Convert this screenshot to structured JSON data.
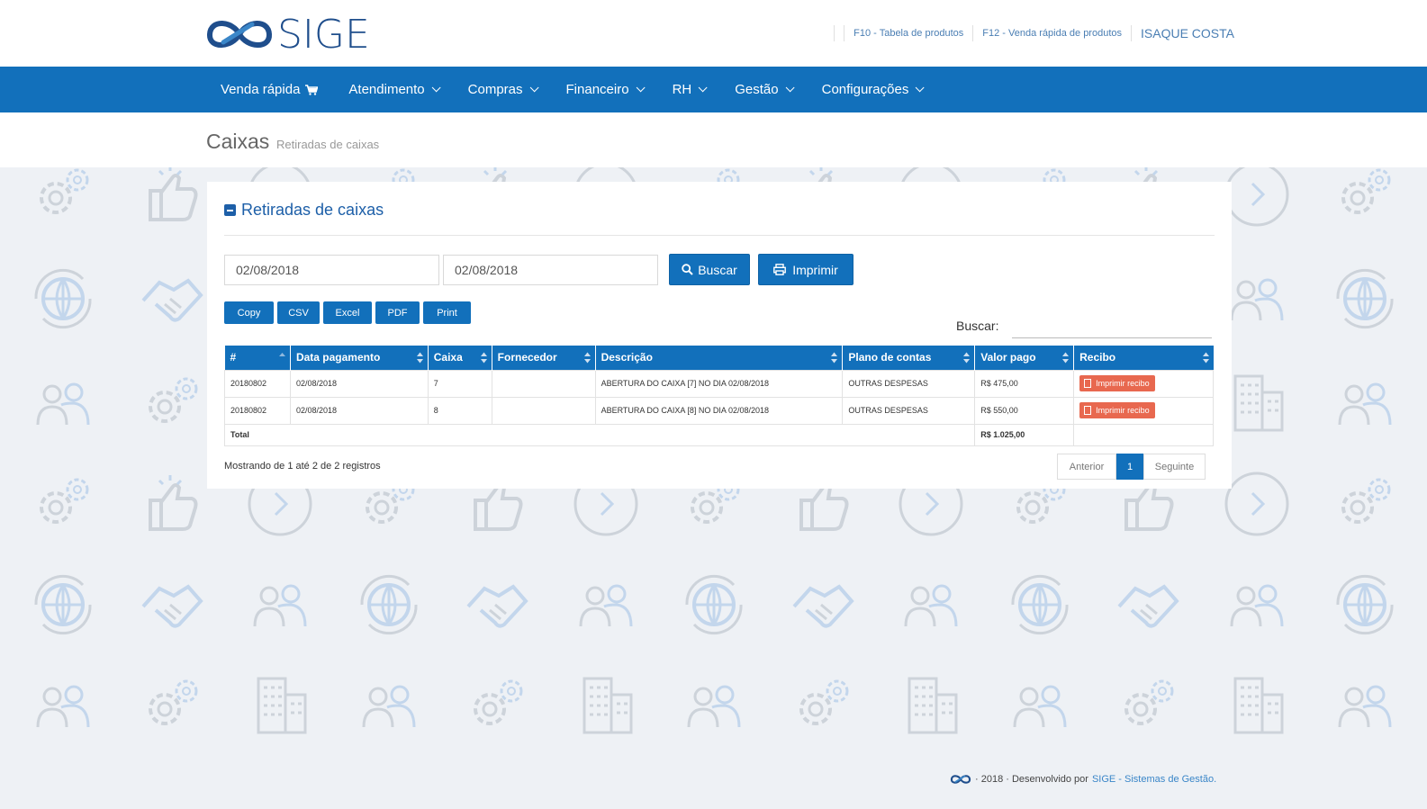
{
  "header": {
    "logo_text": "SIGE",
    "links": [
      "F10 - Tabela de produtos",
      "F12 - Venda rápida de produtos"
    ],
    "user": "ISAQUE COSTA"
  },
  "nav": {
    "items": [
      {
        "label": "Venda rápida",
        "icon": "cart-icon"
      },
      {
        "label": "Atendimento",
        "icon": "chevron-down-icon"
      },
      {
        "label": "Compras",
        "icon": "chevron-down-icon"
      },
      {
        "label": "Financeiro",
        "icon": "chevron-down-icon"
      },
      {
        "label": "RH",
        "icon": "chevron-down-icon"
      },
      {
        "label": "Gestão",
        "icon": "chevron-down-icon"
      },
      {
        "label": "Configurações",
        "icon": "chevron-down-icon"
      }
    ]
  },
  "page": {
    "title": "Caixas",
    "subtitle": "Retiradas de caixas"
  },
  "panel": {
    "title": "Retiradas de caixas",
    "date_from": "02/08/2018",
    "date_to": "02/08/2018",
    "buscar_button": "Buscar",
    "imprimir_button": "Imprimir",
    "export_buttons": [
      "Copy",
      "CSV",
      "Excel",
      "PDF",
      "Print"
    ],
    "search_label": "Buscar:",
    "search_value": ""
  },
  "table": {
    "columns": [
      "#",
      "Data pagamento",
      "Caixa",
      "Fornecedor",
      "Descrição",
      "Plano de contas",
      "Valor pago",
      "Recibo"
    ],
    "rows": [
      {
        "id": "20180802",
        "data": "02/08/2018",
        "caixa": "7",
        "fornecedor": "",
        "descricao": "ABERTURA DO CAIXA [7] NO DIA 02/08/2018",
        "plano": "OUTRAS DESPESAS",
        "valor": "R$ 475,00",
        "recibo": "Imprimir recibo"
      },
      {
        "id": "20180802",
        "data": "02/08/2018",
        "caixa": "8",
        "fornecedor": "",
        "descricao": "ABERTURA DO CAIXA [8] NO DIA 02/08/2018",
        "plano": "OUTRAS DESPESAS",
        "valor": "R$ 550,00",
        "recibo": "Imprimir recibo"
      }
    ],
    "total_label": "Total",
    "total_value": "R$ 1.025,00"
  },
  "pagination": {
    "info": "Mostrando de 1 até 2 de 2 registros",
    "prev": "Anterior",
    "current": "1",
    "next": "Seguinte"
  },
  "footer": {
    "text": "· 2018 · Desenvolvido por",
    "link": "SIGE - Sistemas de Gestão."
  },
  "colors": {
    "primary": "#1270bb",
    "accent_red": "#e8684f",
    "background": "#eef1f5"
  }
}
